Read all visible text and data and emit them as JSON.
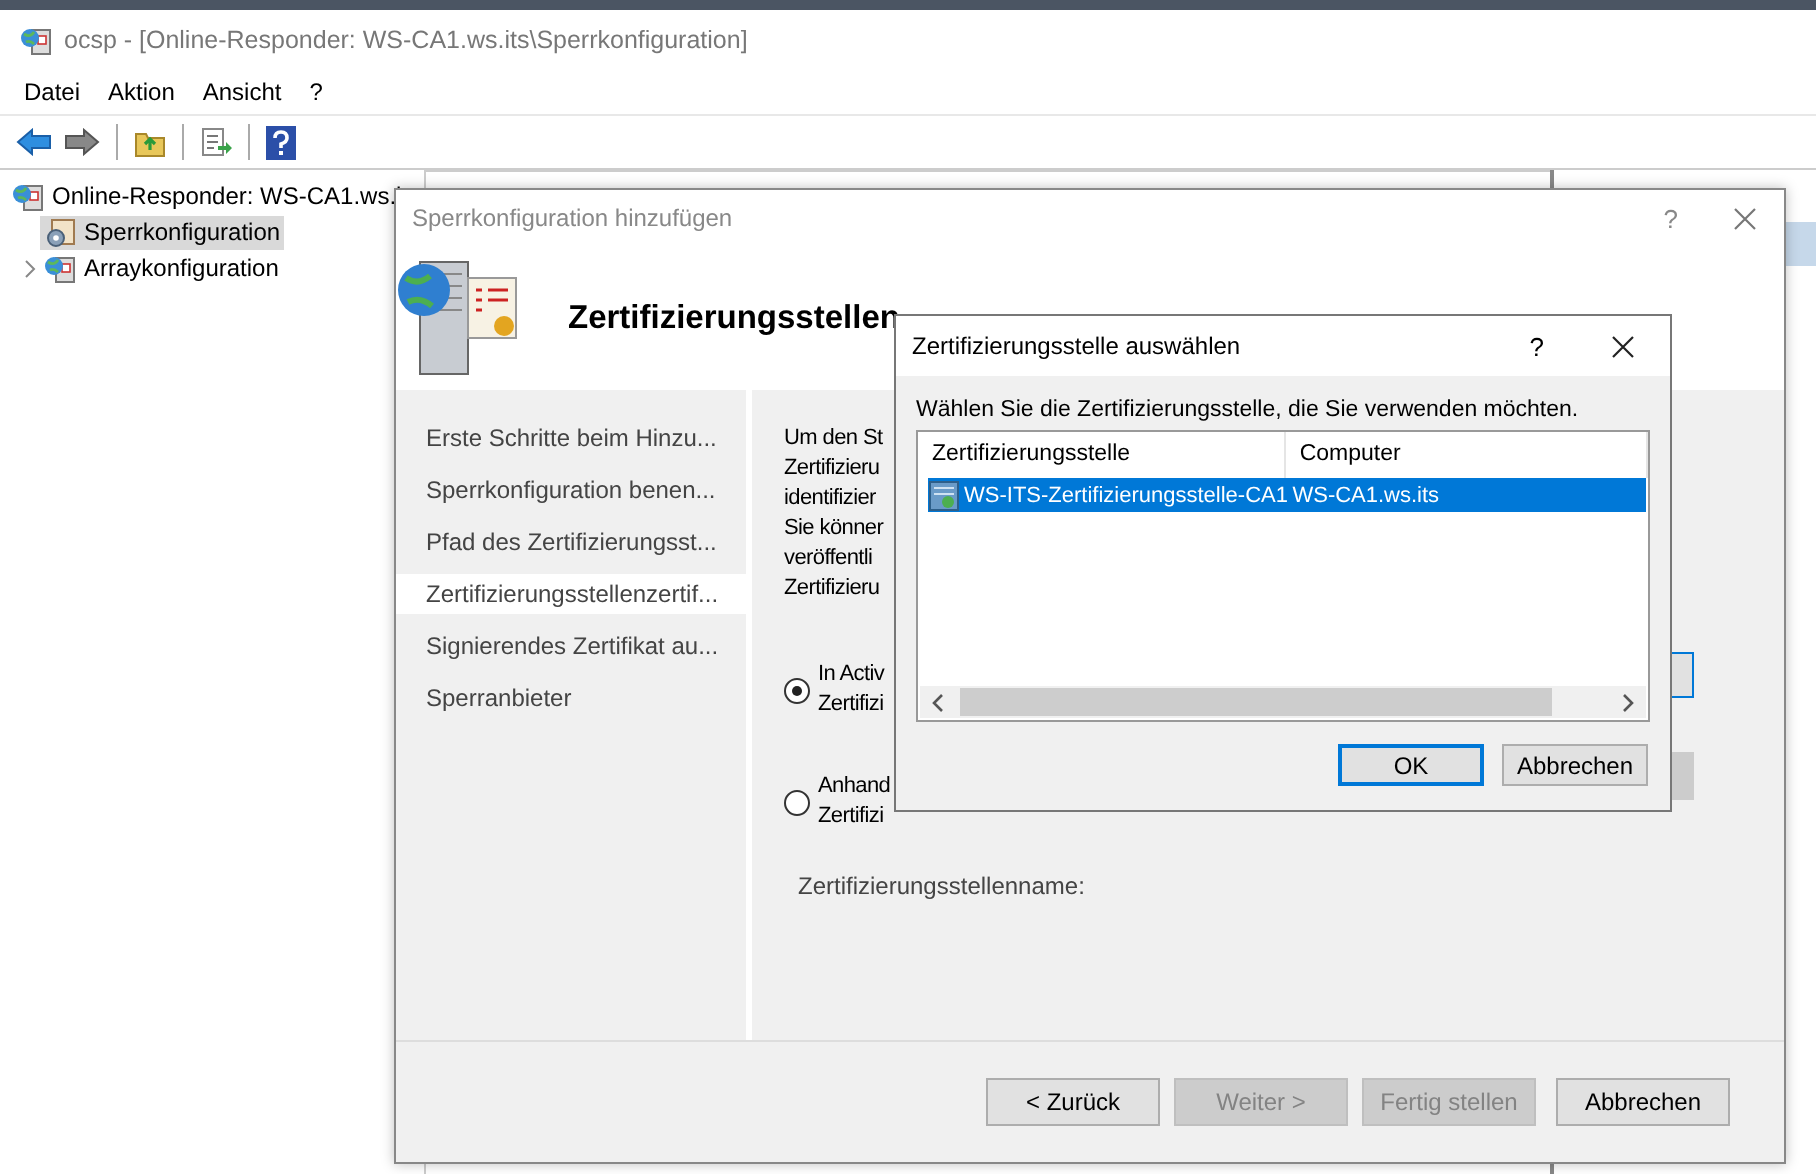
{
  "window": {
    "title": "ocsp - [Online-Responder: WS-CA1.ws.its\\Sperrkonfiguration]"
  },
  "menu": [
    "Datei",
    "Aktion",
    "Ansicht",
    "?"
  ],
  "tree": [
    {
      "label": "Online-Responder: WS-CA1.ws.i",
      "selected": false,
      "children": [
        {
          "label": "Sperrkonfiguration",
          "selected": true
        },
        {
          "label": "Arraykonfiguration",
          "selected": false,
          "expanded": false
        }
      ]
    }
  ],
  "wizard": {
    "title": "Sperrkonfiguration hinzufügen",
    "help": "?",
    "heading": "Zertifizierungsstellen",
    "steps": [
      {
        "label": "Erste Schritte beim Hinzu...",
        "selected": false
      },
      {
        "label": "Sperrkonfiguration benen...",
        "selected": false
      },
      {
        "label": "Pfad des Zertifizierungsst...",
        "selected": false
      },
      {
        "label": "Zertifizierungsstellenzertif...",
        "selected": true
      },
      {
        "label": "Signierendes Zertifikat au...",
        "selected": false
      },
      {
        "label": "Sperranbieter",
        "selected": false
      }
    ],
    "intro_lines": [
      "Um den St",
      "Zertifizieru",
      "identifizier",
      "Sie könner",
      "veröffentli",
      "Zertifizieru"
    ],
    "options": [
      {
        "lines": [
          "In Activ",
          "Zertifizi"
        ],
        "selected": true
      },
      {
        "lines": [
          "Anhand",
          "Zertifizi"
        ],
        "selected": false
      }
    ],
    "name_label": "Zertifizierungsstellenname:",
    "buttons": [
      {
        "label": "< Zurück",
        "disabled": false
      },
      {
        "label": "Weiter >",
        "disabled": true
      },
      {
        "label": "Fertig stellen",
        "disabled": true
      },
      {
        "label": "Abbrechen",
        "disabled": false
      }
    ]
  },
  "ca_dialog": {
    "title": "Zertifizierungsstelle auswählen",
    "help": "?",
    "prompt": "Wählen Sie die Zertifizierungsstelle, die Sie verwenden möchten.",
    "columns": [
      "Zertifizierungsstelle",
      "Computer"
    ],
    "rows": [
      {
        "cells": [
          "WS-ITS-Zertifizierungsstelle-CA1",
          "WS-CA1.ws.its"
        ],
        "selected": true
      }
    ],
    "buttons": [
      {
        "label": "OK",
        "default": true
      },
      {
        "label": "Abbrechen",
        "default": false
      }
    ]
  }
}
